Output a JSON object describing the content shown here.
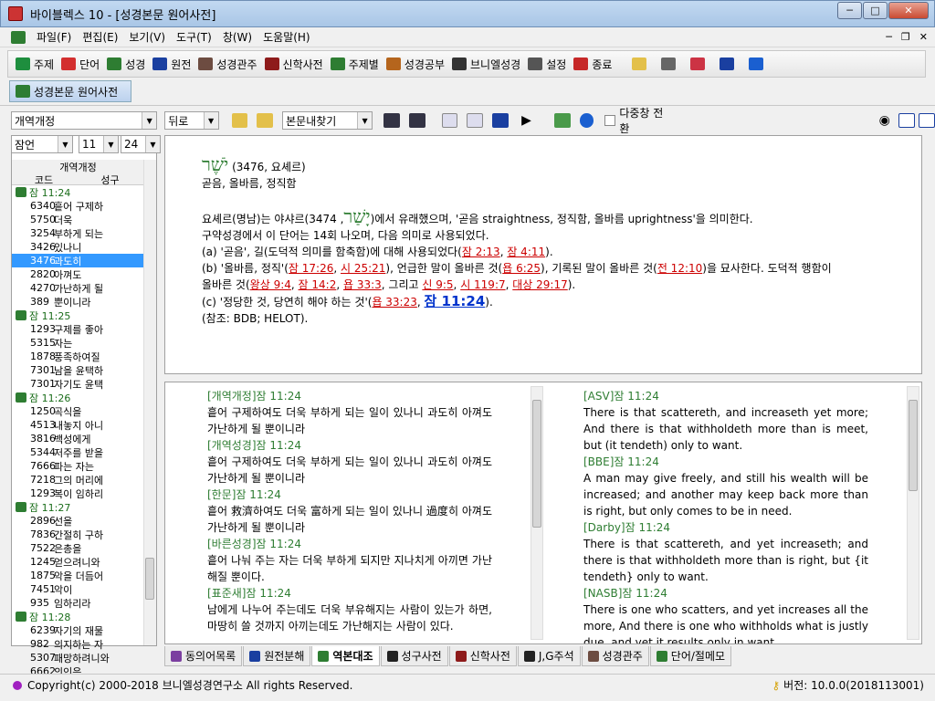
{
  "window": {
    "title": "바이블렉스 10 - [성경본문 원어사전]"
  },
  "menu": [
    "파일(F)",
    "편집(E)",
    "보기(V)",
    "도구(T)",
    "창(W)",
    "도움말(H)"
  ],
  "toolbar": [
    {
      "label": "주제",
      "icon": "arrow-icon",
      "color": "#1e8e3e"
    },
    {
      "label": "단어",
      "icon": "arrow-icon",
      "color": "#d32f2f"
    },
    {
      "label": "성경",
      "icon": "book-icon",
      "color": "#2e7d32"
    },
    {
      "label": "원전",
      "icon": "book-icon",
      "color": "#1a3fa0"
    },
    {
      "label": "성경관주",
      "icon": "book-icon",
      "color": "#6d4c41"
    },
    {
      "label": "신학사전",
      "icon": "book-icon",
      "color": "#8e1b1b"
    },
    {
      "label": "주제별",
      "icon": "grid-icon",
      "color": "#2e7d32"
    },
    {
      "label": "성경공부",
      "icon": "book-icon",
      "color": "#b5651d"
    },
    {
      "label": "브니엘성경",
      "icon": "book-icon",
      "color": "#333333"
    },
    {
      "label": "설정",
      "icon": "settings-icon",
      "color": "#555555"
    },
    {
      "label": "종료",
      "icon": "exit-icon",
      "color": "#c62828"
    }
  ],
  "doc_tab": "성경본문 원어사전",
  "subtoolbar": {
    "version": "개역개정",
    "back": "뒤로",
    "search": "본문내찾기",
    "multi_window": "다중창 전환"
  },
  "nav": {
    "book": "잠언",
    "chapter": "11",
    "verse": "24"
  },
  "list": {
    "group": "개역개정",
    "col_code": "코드",
    "col_word": "성구",
    "rows": [
      {
        "type": "verse",
        "text": "잠 11:24"
      },
      {
        "type": "word",
        "code": "6340",
        "text": "흩어 구제하"
      },
      {
        "type": "word",
        "code": "5750",
        "text": "더욱"
      },
      {
        "type": "word",
        "code": "3254",
        "text": "부하게 되는"
      },
      {
        "type": "word",
        "code": "3426",
        "text": "있나니"
      },
      {
        "type": "word",
        "code": "3476",
        "text": "과도히",
        "selected": true
      },
      {
        "type": "word",
        "code": "2820",
        "text": "아껴도"
      },
      {
        "type": "word",
        "code": "4270",
        "text": "가난하게 될"
      },
      {
        "type": "word",
        "code": "389",
        "text": "뿐이니라"
      },
      {
        "type": "verse",
        "text": "잠 11:25"
      },
      {
        "type": "word",
        "code": "1293",
        "text": "구제를 좋아"
      },
      {
        "type": "word",
        "code": "5315",
        "text": "자는"
      },
      {
        "type": "word",
        "code": "1878",
        "text": "풍족하여질"
      },
      {
        "type": "word",
        "code": "7301",
        "text": "남을 윤택하"
      },
      {
        "type": "word",
        "code": "7301",
        "text": "자기도 윤택"
      },
      {
        "type": "verse",
        "text": "잠 11:26"
      },
      {
        "type": "word",
        "code": "1250",
        "text": "곡식을"
      },
      {
        "type": "word",
        "code": "4513",
        "text": "내놓지 아니"
      },
      {
        "type": "word",
        "code": "3816",
        "text": "백성에게"
      },
      {
        "type": "word",
        "code": "5344",
        "text": "저주를 받을"
      },
      {
        "type": "word",
        "code": "7666",
        "text": "파는 자는"
      },
      {
        "type": "word",
        "code": "7218",
        "text": "그의 머리에"
      },
      {
        "type": "word",
        "code": "1293",
        "text": "복이 임하리"
      },
      {
        "type": "verse",
        "text": "잠 11:27"
      },
      {
        "type": "word",
        "code": "2896",
        "text": "선을"
      },
      {
        "type": "word",
        "code": "7836",
        "text": "간절히 구하"
      },
      {
        "type": "word",
        "code": "7522",
        "text": "은총을"
      },
      {
        "type": "word",
        "code": "1245",
        "text": "얻으려니와"
      },
      {
        "type": "word",
        "code": "1875",
        "text": "악을 더듬어"
      },
      {
        "type": "word",
        "code": "7451",
        "text": "악이"
      },
      {
        "type": "word",
        "code": "935",
        "text": "임하리라"
      },
      {
        "type": "verse",
        "text": "잠 11:28"
      },
      {
        "type": "word",
        "code": "6239",
        "text": "자기의 재물"
      },
      {
        "type": "word",
        "code": "982",
        "text": "의지하는 자"
      },
      {
        "type": "word",
        "code": "5307",
        "text": "패망하려니와"
      },
      {
        "type": "word",
        "code": "6662",
        "text": "의인은"
      }
    ]
  },
  "dict": {
    "hebrew": "יֹשֶׁר",
    "head_tail": "(3476, 요셰르)",
    "gloss": "곧음, 올바름, 정직함",
    "p1_a": "요셰르(명남)는 야샤르(",
    "p1_heb": "יָשַׁר",
    "p1_b": ", 3474)에서 유래했으며, '곧음 straightness, 정직함, 올바름 uprightness'을 의미한다.",
    "p2": "구약성경에서 이 단어는 14회 나오며, 다음 의미로 사용되었다.",
    "a_pre": "(a) '곧음', 길(도덕적 의미를 함축함)에 대해 사용되었다(",
    "a_r1": "잠 2:13",
    "a_sep": ", ",
    "a_r2": "잠 4:11",
    "a_post": ").",
    "b_pre": "(b) '올바름, 정직'(",
    "b_r1": "잠 17:26",
    "b_r2": "시 25:21",
    "b_mid1": "), 언급한 말이 올바른 것(",
    "b_r3": "욥 6:25",
    "b_mid2": "), 기록된 말이 올바른 것(",
    "b_r4": "전 12:10",
    "b_mid3": ")을 묘사한다. 도덕적 행함이",
    "b2_pre": "올바른 것(",
    "b2_r1": "왕상 9:4",
    "b2_r2": "잠 14:2",
    "b2_r3": "욥 33:3",
    "b2_and": ", 그리고 ",
    "b2_r4": "신 9:5",
    "b2_r5": "시 119:7",
    "b2_r6": "대상 29:17",
    "b2_post": ").",
    "c_pre": "(c) '정당한 것, 당연히 해야 하는 것'(",
    "c_r1": "욥 33:23",
    "c_r2": "잠 11:24",
    "c_post": ").",
    "note": "(참조: BDB; HELOT)."
  },
  "translations_left": [
    {
      "head": "[개역개정]잠 11:24",
      "text": "흩어 구제하여도 더욱 부하게 되는 일이 있나니 과도히 아껴도 가난하게 될 뿐이니라"
    },
    {
      "head": "[개역성경]잠 11:24",
      "text": "흩어 구제하여도 더욱 부하게 되는 일이 있나니 과도히 아껴도 가난하게 될 뿐이니라"
    },
    {
      "head": "[한문]잠 11:24",
      "text": "흩어 救濟하여도 더욱 富하게 되는 일이 있나니 過度히 아껴도 가난하게 될 뿐이니라"
    },
    {
      "head": "[바른성경]잠 11:24",
      "text": "흩어 나눠 주는 자는 더욱 부하게 되지만 지나치게 아끼면 가난해질 뿐이다."
    },
    {
      "head": "[표준새]잠 11:24",
      "text": "남에게 나누어 주는데도 더욱 부유해지는 사람이 있는가 하면, 마땅히 쓸 것까지 아끼는데도 가난해지는 사람이 있다."
    }
  ],
  "translations_right": [
    {
      "head": "[ASV]잠 11:24",
      "text": "There is that scattereth, and increaseth yet more; And there is that withholdeth more than is meet, but (it tendeth) only to want."
    },
    {
      "head": "[BBE]잠 11:24",
      "text": "A man may give freely, and still his wealth will be increased; and another may keep back more than is right, but only comes to be in need."
    },
    {
      "head": "[Darby]잠 11:24",
      "text": "There is that scattereth, and yet increaseth; and there is that withholdeth more than is right, but {it tendeth} only to want."
    },
    {
      "head": "[NASB]잠 11:24",
      "text": "There is one who scatters, and yet increases all the more, And there is one who withholds what is justly due, and yet it results only in want."
    }
  ],
  "bottom_tabs": [
    {
      "label": "동의어목록",
      "color": "#7b3fa0"
    },
    {
      "label": "원전분해",
      "color": "#1a3fa0"
    },
    {
      "label": "역본대조",
      "color": "#2e7d32",
      "active": true
    },
    {
      "label": "성구사전",
      "color": "#222222"
    },
    {
      "label": "신학사전",
      "color": "#8e1b1b"
    },
    {
      "label": "J,G주석",
      "color": "#222222"
    },
    {
      "label": "성경관주",
      "color": "#6d4c41"
    },
    {
      "label": "단어/절메모",
      "color": "#2e7d32"
    }
  ],
  "status": {
    "copyright": "Copyright(c) 2000-2018 브니엘성경연구소 All rights Reserved.",
    "version": "버전: 10.0.0(2018113001)"
  }
}
